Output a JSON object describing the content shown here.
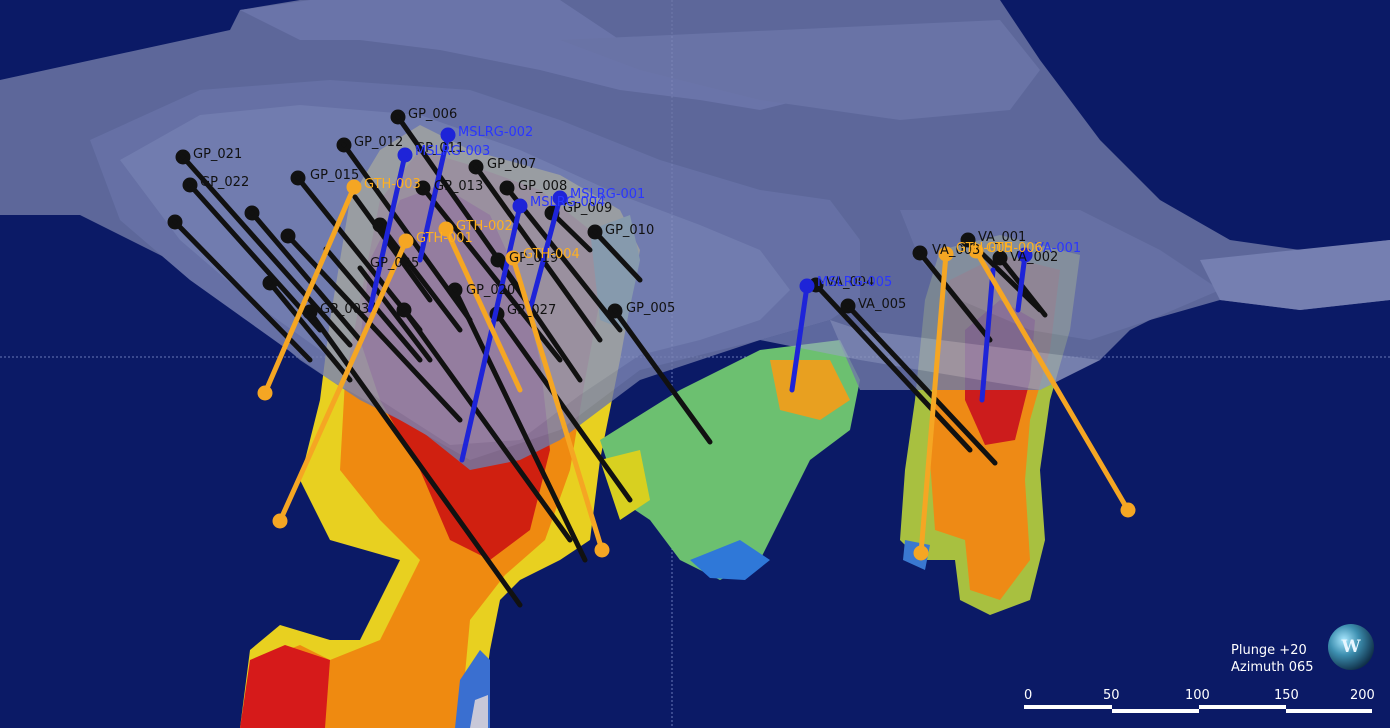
{
  "view": {
    "plunge_label": "Plunge +20",
    "azimuth_label": "Azimuth 065",
    "compass_letter": "W",
    "scale_ticks": [
      "0",
      "50",
      "100",
      "150",
      "200"
    ]
  },
  "colors": {
    "background": "#0b1a66",
    "pit_surface": "#6f79a6",
    "drillhole_black": "#111111",
    "drillhole_blue": "#1e24d8",
    "drillhole_orange": "#f5a623",
    "label_black": "#111111",
    "label_blue": "#2a36ff",
    "label_orange": "#ffb020"
  },
  "drillholes": {
    "black": [
      "GP_006",
      "GP_021",
      "GP_022",
      "GP_012",
      "GP_011",
      "GP_015",
      "GP_007",
      "GP_013",
      "GP_008",
      "GP_009",
      "GP_010",
      "GP_005",
      "GP_019",
      "GP_025",
      "GP_020",
      "GP_027",
      "GP_003",
      "VA_001",
      "VA_002",
      "VA_003",
      "VA_004",
      "VA_005"
    ],
    "blue": [
      "MSLRG-002",
      "MSLRG-003",
      "MSLRG-001",
      "MSLRG-004",
      "MSLRG-005",
      "VA-001"
    ],
    "orange": [
      "GTH-003",
      "GTH-002",
      "GTH-001",
      "GTH-004",
      "GTH-005",
      "GTH-006"
    ]
  }
}
